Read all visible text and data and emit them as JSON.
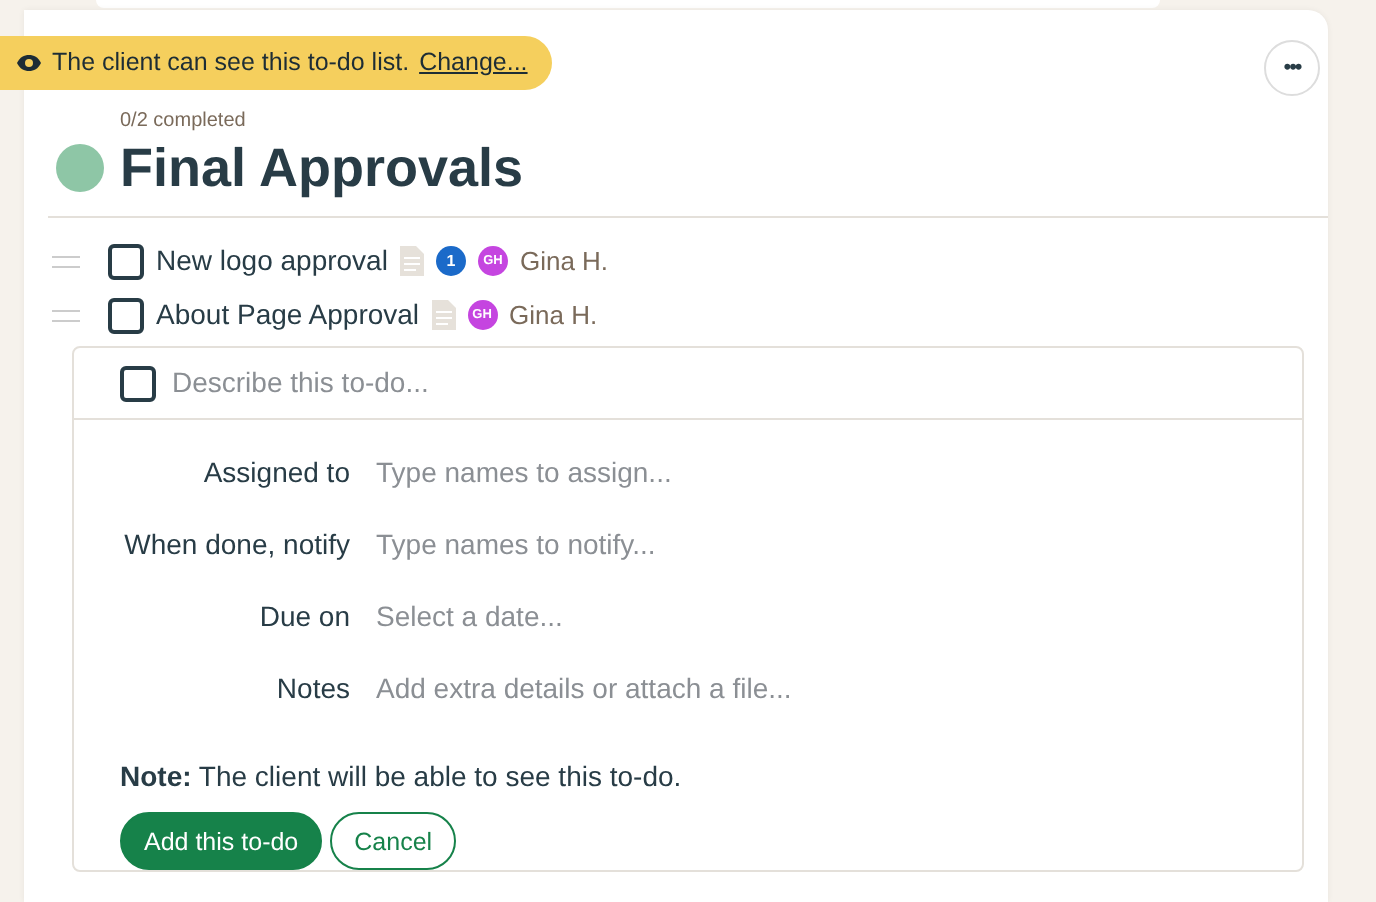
{
  "banner": {
    "text": "The client can see this to-do list.",
    "link": "Change..."
  },
  "list": {
    "progress": "0/2 completed",
    "title": "Final Approvals",
    "menu": "•••"
  },
  "todos": [
    {
      "text": "New logo approval",
      "checked": false,
      "has_notes": true,
      "comments": "1",
      "assignee_initials": "GH",
      "assignee": "Gina H."
    },
    {
      "text": "About Page Approval",
      "checked": false,
      "has_notes": true,
      "assignee_initials": "GH",
      "assignee": "Gina H."
    }
  ],
  "new_todo": {
    "checked": false,
    "placeholder": "Describe this to-do...",
    "fields": [
      {
        "label": "Assigned to",
        "placeholder": "Type names to assign..."
      },
      {
        "label": "When done, notify",
        "placeholder": "Type names to notify..."
      },
      {
        "label": "Due on",
        "placeholder": "Select a date..."
      },
      {
        "label": "Notes",
        "placeholder": "Add extra details or attach a file..."
      }
    ],
    "note": "**Note:** The client will be able to see this to-do.",
    "buttons": [
      {
        "label": "Add this to-do",
        "kind": "primary"
      },
      {
        "label": "Cancel",
        "kind": "secondary"
      }
    ]
  }
}
